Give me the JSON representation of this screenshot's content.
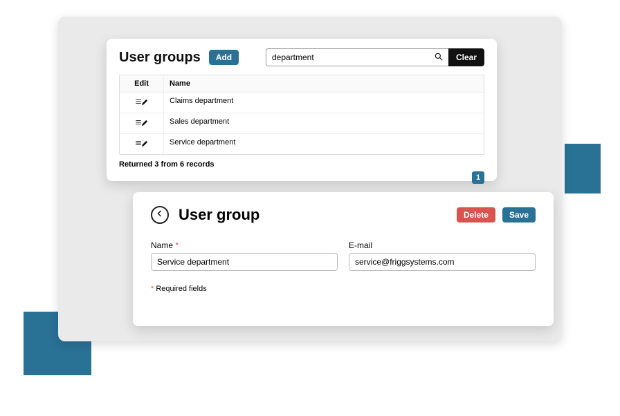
{
  "list": {
    "title": "User groups",
    "add_label": "Add",
    "search_value": "department",
    "search_placeholder": "",
    "clear_label": "Clear",
    "columns": {
      "edit": "Edit",
      "name": "Name"
    },
    "rows": [
      {
        "name": "Claims department"
      },
      {
        "name": "Sales department"
      },
      {
        "name": "Service department"
      }
    ],
    "returned_text": "Returned 3 from 6 records",
    "page_current": "1"
  },
  "detail": {
    "title": "User group",
    "delete_label": "Delete",
    "save_label": "Save",
    "fields": {
      "name": {
        "label": "Name",
        "required": "*",
        "value": "Service department"
      },
      "email": {
        "label": "E-mail",
        "required": "",
        "value": "service@friggsystems.com"
      }
    },
    "required_note_marker": "*",
    "required_note_text": " Required fields"
  }
}
